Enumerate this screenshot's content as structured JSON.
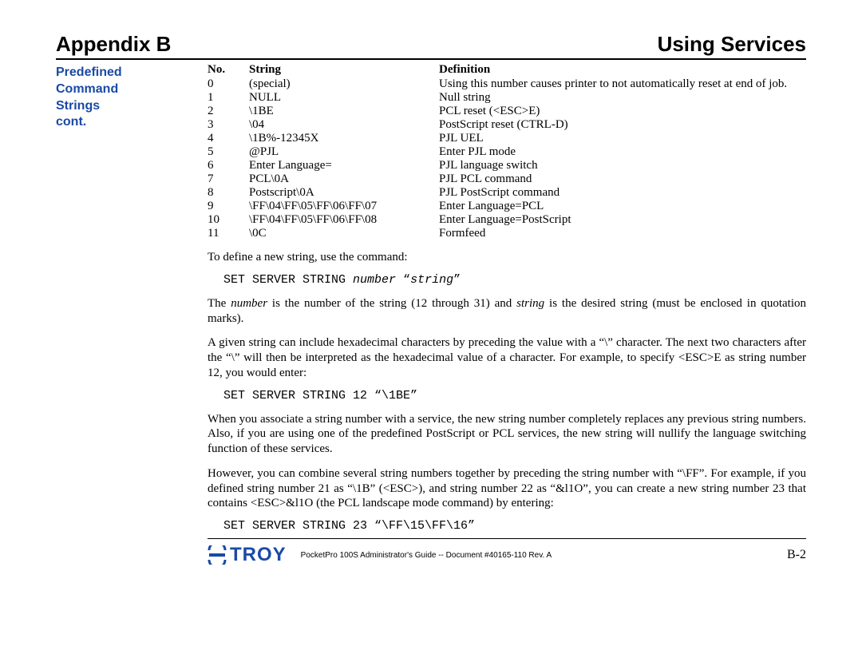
{
  "header": {
    "left": "Appendix B",
    "right": "Using Services"
  },
  "sidebar": {
    "title_line1": "Predefined",
    "title_line2": "Command",
    "title_line3": "Strings",
    "title_line4": "cont."
  },
  "table": {
    "head_no": "No.",
    "head_string": "String",
    "head_def": "Definition",
    "rows": [
      {
        "n": "0",
        "s": "(special)",
        "d": "Using this number causes printer to not automatically reset at end of job."
      },
      {
        "n": "1",
        "s": "NULL",
        "d": "Null string"
      },
      {
        "n": "2",
        "s": "\\1BE",
        "d": "PCL reset (<ESC>E)"
      },
      {
        "n": "3",
        "s": "\\04",
        "d": "PostScript reset (CTRL-D)"
      },
      {
        "n": "4",
        "s": "\\1B%-12345X",
        "d": "PJL UEL"
      },
      {
        "n": "5",
        "s": "@PJL",
        "d": "Enter PJL mode"
      },
      {
        "n": "6",
        "s": "Enter Language=",
        "d": "PJL language switch"
      },
      {
        "n": "7",
        "s": "PCL\\0A",
        "d": "PJL PCL command"
      },
      {
        "n": "8",
        "s": "Postscript\\0A",
        "d": "PJL PostScript command"
      },
      {
        "n": "9",
        "s": "\\FF\\04\\FF\\05\\FF\\06\\FF\\07",
        "d": "Enter Language=PCL"
      },
      {
        "n": "10",
        "s": "\\FF\\04\\FF\\05\\FF\\06\\FF\\08",
        "d": "Enter Language=PostScript"
      },
      {
        "n": "11",
        "s": "\\0C",
        "d": "Formfeed"
      }
    ]
  },
  "body": {
    "p1": "To define a new string, use the command:",
    "code1_a": "SET SERVER STRING ",
    "code1_b": "number",
    "code1_c": " “",
    "code1_d": "string",
    "code1_e": "”",
    "p2_a": "The ",
    "p2_b": "number",
    "p2_c": " is the number of the string (12 through 31) and ",
    "p2_d": "string",
    "p2_e": " is the desired string (must be enclosed in quotation marks).",
    "p3": "A given string can include hexadecimal characters by preceding the value with a “\\” character.  The next two characters after the “\\” will then be interpreted as the hexadecimal value of a character.  For example, to specify <ESC>E as string number 12, you would enter:",
    "code2": "SET SERVER STRING 12 “\\1BE”",
    "p4": "When you associate a string number with a service, the new string number completely replaces any previous string numbers.  Also, if you are using one of the predefined PostScript or PCL services, the new string will nullify the language switching function of these services.",
    "p5": "However, you can combine several string numbers together by preceding the string number with “\\FF”.  For example, if you defined string number 21 as “\\1B” (<ESC>), and string number 22 as “&l1O”, you can create a new string number 23 that contains <ESC>&l1O (the PCL landscape mode command) by entering:",
    "code3": "SET SERVER STRING 23 “\\FF\\15\\FF\\16”"
  },
  "footer": {
    "brand": "TROY",
    "doc": "PocketPro 100S Administrator's Guide -- Document #40165-110  Rev. A",
    "page": "B-2"
  }
}
